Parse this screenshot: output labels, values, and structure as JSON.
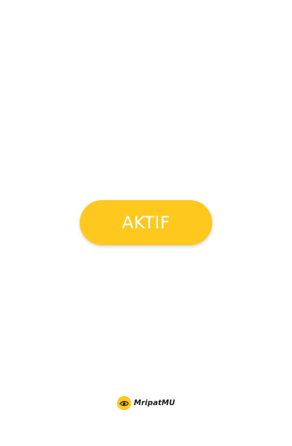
{
  "main": {
    "button_label": "AKTIF"
  },
  "footer": {
    "brand_name": "MripatMU",
    "logo_icon": "eye-logo-icon"
  },
  "colors": {
    "accent": "#FFC81E",
    "background": "#FFFFFF",
    "button_text": "#FFFFFF",
    "brand_text": "#1A1A1A"
  }
}
